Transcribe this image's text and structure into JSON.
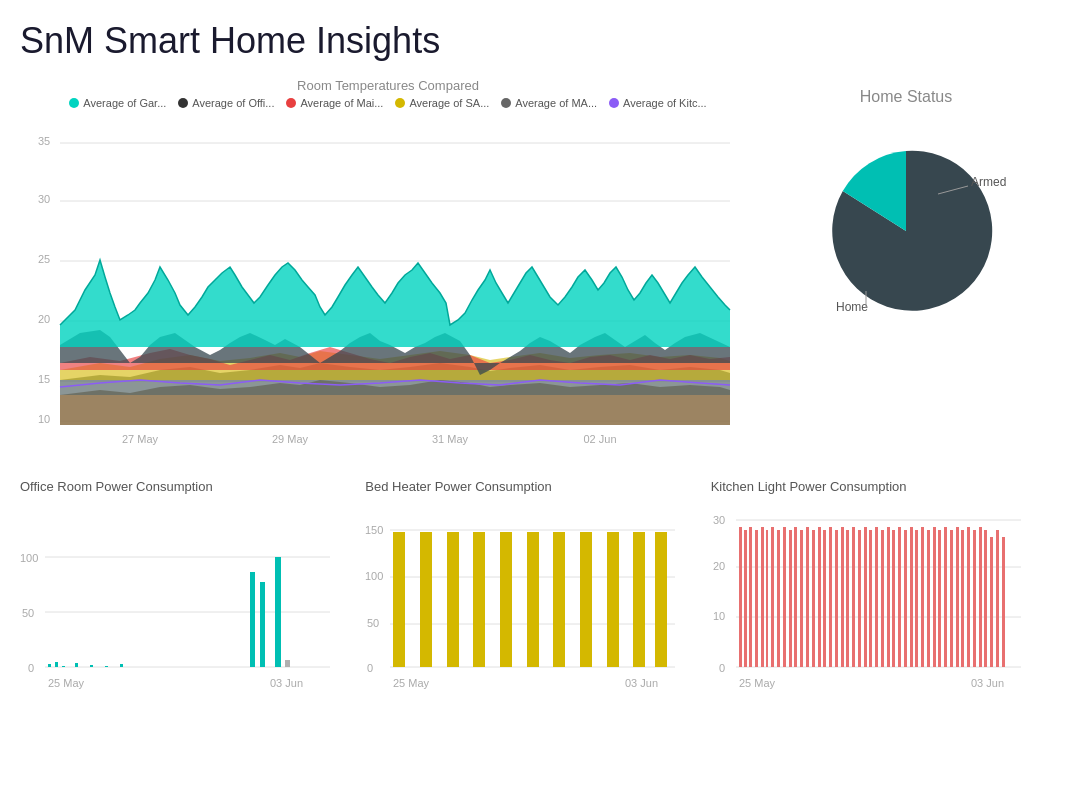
{
  "app": {
    "title": "SnM Smart Home Insights"
  },
  "main_chart": {
    "title": "Room Temperatures Compared",
    "legend": [
      {
        "label": "Average of Gar...",
        "color": "#00d4c0"
      },
      {
        "label": "Average of Offi...",
        "color": "#333333"
      },
      {
        "label": "Average of Mai...",
        "color": "#e84040"
      },
      {
        "label": "Average of SA...",
        "color": "#d4b800"
      },
      {
        "label": "Average of MA...",
        "color": "#666666"
      },
      {
        "label": "Average of Kitc...",
        "color": "#8b5cf6"
      }
    ],
    "y_axis": [
      10,
      15,
      20,
      25,
      30,
      35
    ],
    "x_axis": [
      "27 May",
      "29 May",
      "31 May",
      "02 Jun"
    ]
  },
  "home_status": {
    "title": "Home Status",
    "segments": [
      {
        "label": "Armed",
        "value": 25,
        "color": "#00bfb3"
      },
      {
        "label": "Home",
        "value": 75,
        "color": "#37474f"
      }
    ]
  },
  "bottom_charts": [
    {
      "title": "Office Room Power Consumption",
      "color": "#00bfb3",
      "y_max": 100,
      "y_labels": [
        0,
        50,
        100
      ],
      "x_labels": [
        "25 May",
        "03 Jun"
      ]
    },
    {
      "title": "Bed Heater Power Consumption",
      "color": "#d4b800",
      "y_max": 150,
      "y_labels": [
        0,
        50,
        100,
        150
      ],
      "x_labels": [
        "25 May",
        "03 Jun"
      ]
    },
    {
      "title": "Kitchen Light Power Consumption",
      "color": "#e87070",
      "y_max": 30,
      "y_labels": [
        0,
        10,
        20,
        30
      ],
      "x_labels": [
        "25 May",
        "03 Jun"
      ]
    }
  ]
}
